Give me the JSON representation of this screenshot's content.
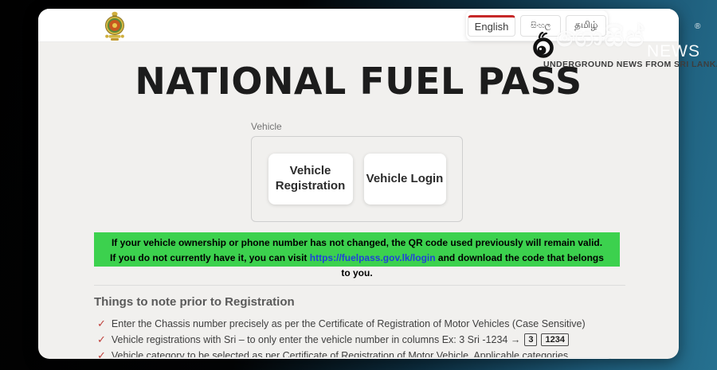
{
  "header": {
    "emblem_icon": "sri-lanka-government-emblem",
    "language_tabs": [
      {
        "label": "English",
        "active": true
      },
      {
        "label": "සිංහල",
        "active": false
      },
      {
        "label": "தமிழ்",
        "active": false
      }
    ]
  },
  "title": "NATIONAL FUEL PASS",
  "vehicle_section": {
    "label": "Vehicle",
    "registration_button": "Vehicle Registration",
    "login_button": "Vehicle Login"
  },
  "notice": {
    "text_before_link": "If your vehicle ownership or phone number has not changed, the QR code used previously will remain valid. If you do not currently have it, you can visit",
    "link_text": "https://fuelpass.gov.lk/login",
    "text_after_link": "and download the code that belongs to you."
  },
  "notes": {
    "heading": "Things to note prior to Registration",
    "check_glyph": "✓",
    "items": [
      {
        "text": "Enter the Chassis number precisely as per the Certificate of Registration of Motor Vehicles (Case Sensitive)"
      },
      {
        "text": "Vehicle registrations with Sri – to only enter the vehicle number in columns Ex: 3 Sri -1234 →",
        "boxes": [
          "3",
          "1234"
        ]
      },
      {
        "text": "Vehicle category to be selected as per Certificate of Registration of Motor Vehicle. Applicable categories"
      }
    ]
  },
  "watermark": {
    "brand_text": "ගොසිප්",
    "news_text": "NEWS",
    "registered_mark": "®",
    "tagline": "UNDERGROUND NEWS FROM SRI LANKA"
  },
  "colors": {
    "notice_green": "#3cd14e",
    "active_tab_red": "#c62828",
    "link_blue": "#2043d8",
    "backdrop_teal": "#1f607f",
    "check_red": "#c0403c"
  }
}
